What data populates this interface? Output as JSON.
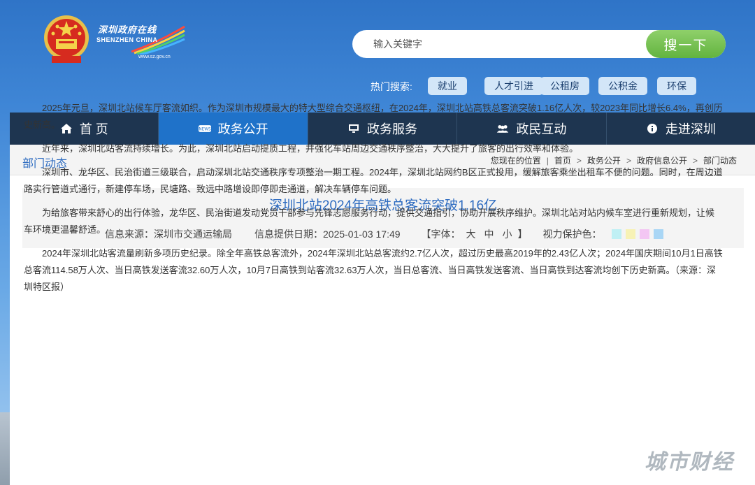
{
  "header": {
    "logo_cn": "深圳政府在线",
    "logo_en": "SHENZHEN CHINA",
    "logo_url": "www.sz.gov.cn",
    "search_placeholder": "输入关键字",
    "search_button": "搜一下",
    "hot_label": "热门搜索:",
    "hot_tags": [
      "就业",
      "人才引进",
      "公租房",
      "公积金",
      "环保"
    ]
  },
  "nav": {
    "items": [
      {
        "label": "首 页",
        "icon": "home-icon"
      },
      {
        "label": "政务公开",
        "icon": "news-icon"
      },
      {
        "label": "政务服务",
        "icon": "monitor-icon"
      },
      {
        "label": "政民互动",
        "icon": "people-icon"
      },
      {
        "label": "走进深圳",
        "icon": "info-icon"
      }
    ],
    "active_index": 1
  },
  "breadcrumb": {
    "section_title": "部门动态",
    "location_label": "您现在的位置",
    "items": [
      "首页",
      "政务公开",
      "政府信息公开",
      "部门动态"
    ]
  },
  "article": {
    "title": "深圳北站2024年高铁总客流突破1.16亿",
    "source": "信息来源：深圳市交通运输局",
    "date": "信息提供日期：2025-01-03 17:49",
    "font_label": "【字体：",
    "font_sizes": [
      "大",
      "中",
      "小"
    ],
    "font_close": "】",
    "eye_label": "视力保护色：",
    "eye_colors": [
      "#bff0f4",
      "#f7f2b5",
      "#f3c6f3",
      "#a9d6f5"
    ],
    "paragraphs": [
      "2025年元旦，深圳北站候车厅客流如织。作为深圳市规模最大的特大型综合交通枢纽，在2024年，深圳北站高铁总客流突破1.16亿人次，较2023年同比增长6.4%，再创历史新高。",
      "近年来，深圳北站客流持续增长。为此，深圳北站启动提质工程，并强化车站周边交通秩序整治，大大提升了旅客的出行效率和体验。",
      "深圳市、龙华区、民治街道三级联合，启动深圳北站交通秩序专项整治一期工程。2024年，深圳北站网约B区正式投用，缓解旅客乘坐出租车不便的问题。同时，在周边道路实行管道式通行，新建停车场，民塘路、致远中路增设即停即走通道，解决车辆停车问题。",
      "为给旅客带来舒心的出行体验，龙华区、民治街道发动党员干部参与先锋志愿服务行动，提供交通指引，协助开展秩序维护。深圳北站对站内候车室进行重新规划，让候车环境更温馨舒适。",
      "2024年深圳北站客流量刷新多项历史纪录。除全年高铁总客流外，2024年深圳北站总客流约2.7亿人次，超过历史最高2019年的2.43亿人次；2024年国庆期间10月1日高铁总客流114.58万人次、当日高铁发送客流32.60万人次，10月7日高铁到站客流32.63万人次，当日总客流、当日高铁发送客流、当日高铁到达客流均创下历史新高。（来源：深圳特区报）"
    ]
  },
  "watermark": "城市财经"
}
